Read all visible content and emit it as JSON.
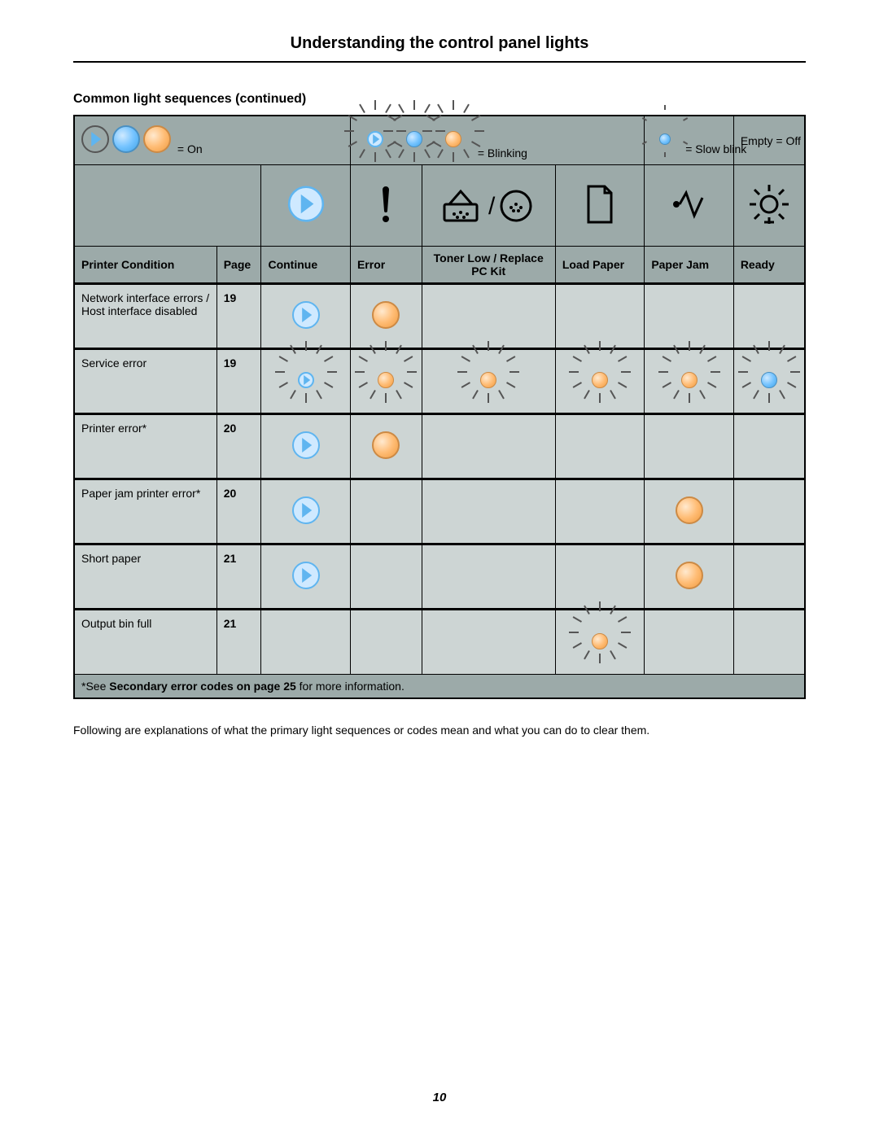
{
  "title": "Understanding the control panel lights",
  "subheading": "Common light sequences (continued)",
  "legend": {
    "on": "= On",
    "blinking": "= Blinking",
    "slow_blink": "= Slow blink",
    "off": "Empty = Off"
  },
  "headers": {
    "condition": "Printer Condition",
    "page": "Page",
    "continue": "Continue",
    "error": "Error",
    "toner": "Toner Low / Replace PC Kit",
    "load_paper": "Load Paper",
    "paper_jam": "Paper Jam",
    "ready": "Ready"
  },
  "rows": [
    {
      "condition": "Network interface errors / Host interface disabled",
      "page": "19",
      "cells": {
        "continue": "on-play",
        "error": "on-orange",
        "toner": "",
        "load_paper": "",
        "paper_jam": "",
        "ready": ""
      }
    },
    {
      "condition": "Service error",
      "page": "19",
      "cells": {
        "continue": "blink-play",
        "error": "blink-orange",
        "toner": "blink-orange",
        "load_paper": "blink-orange",
        "paper_jam": "blink-orange",
        "ready": "blink-blue"
      }
    },
    {
      "condition": "Printer error*",
      "page": "20",
      "cells": {
        "continue": "on-play",
        "error": "on-orange",
        "toner": "",
        "load_paper": "",
        "paper_jam": "",
        "ready": ""
      }
    },
    {
      "condition": "Paper jam printer error*",
      "page": "20",
      "cells": {
        "continue": "on-play",
        "error": "",
        "toner": "",
        "load_paper": "",
        "paper_jam": "on-orange",
        "ready": ""
      }
    },
    {
      "condition": "Short paper",
      "page": "21",
      "cells": {
        "continue": "on-play",
        "error": "",
        "toner": "",
        "load_paper": "",
        "paper_jam": "on-orange",
        "ready": ""
      }
    },
    {
      "condition": "Output bin full",
      "page": "21",
      "cells": {
        "continue": "",
        "error": "",
        "toner": "",
        "load_paper": "blink-orange",
        "paper_jam": "",
        "ready": ""
      }
    }
  ],
  "footnote": {
    "prefix": "*See ",
    "bold": "Secondary error codes on page 25",
    "suffix": " for more information."
  },
  "after_text": "Following are explanations of what the primary light sequences or codes mean and what you can do to clear them.",
  "page_number": "10"
}
